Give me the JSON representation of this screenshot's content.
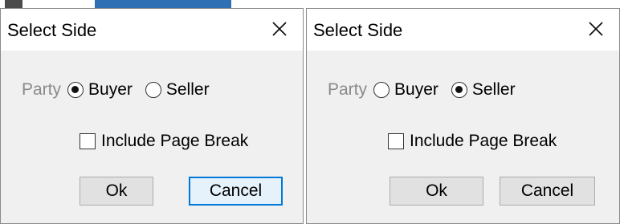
{
  "dialogs": [
    {
      "title": "Select Side",
      "party_label": "Party",
      "options": [
        {
          "label": "Buyer",
          "checked": true
        },
        {
          "label": "Seller",
          "checked": false
        }
      ],
      "include_page_break": {
        "label": "Include Page Break",
        "checked": false
      },
      "ok_label": "Ok",
      "cancel_label": "Cancel",
      "focused_button": "cancel"
    },
    {
      "title": "Select Side",
      "party_label": "Party",
      "options": [
        {
          "label": "Buyer",
          "checked": false
        },
        {
          "label": "Seller",
          "checked": true
        }
      ],
      "include_page_break": {
        "label": "Include Page Break",
        "checked": false
      },
      "ok_label": "Ok",
      "cancel_label": "Cancel",
      "focused_button": "none"
    }
  ],
  "icons": {
    "close": "close-icon"
  },
  "colors": {
    "dialog_bg": "#f0f0f0",
    "titlebar_bg": "#ffffff",
    "focus_border": "#0078d7",
    "muted_label": "#8a8a8a"
  }
}
